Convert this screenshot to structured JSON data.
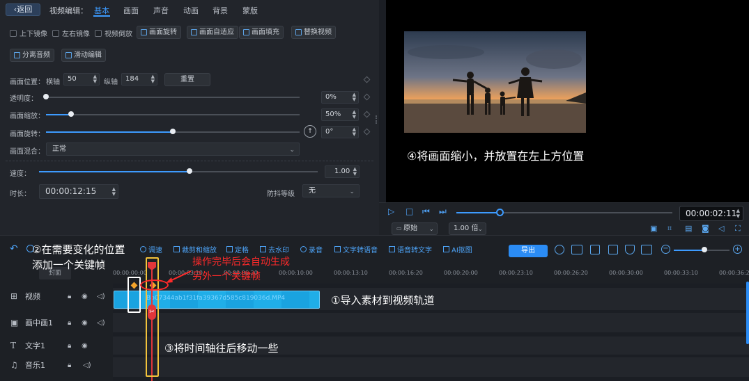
{
  "header": {
    "back_label": "返回",
    "edit_title": "视频编辑：",
    "tabs": [
      "基本",
      "画面",
      "声音",
      "动画",
      "背景",
      "蒙版"
    ]
  },
  "options": {
    "checkboxes": [
      "上下镜像",
      "左右镜像",
      "视频倒放"
    ],
    "buttons_row1": [
      "画面旋转",
      "画面自适应",
      "画面填充",
      "替换视频"
    ],
    "buttons_row2": [
      "分离音频",
      "滑动编辑"
    ]
  },
  "props": {
    "position_label": "画面位置：",
    "x_label": "横轴",
    "x_value": "50",
    "y_label": "纵轴",
    "y_value": "184",
    "reset_label": "重置",
    "opacity_label": "透明度：",
    "opacity_value": "0%",
    "opacity_level": 0.0,
    "scale_label": "画面缩放：",
    "scale_value": "50%",
    "scale_level": 0.1,
    "rotate_label": "画面旋转：",
    "rotate_value": "0°",
    "rotate_level": 0.5,
    "blend_label": "画面混合：",
    "blend_value": "正常",
    "speed_label": "速度：",
    "speed_value": "1.00",
    "speed_level": 0.54,
    "duration_label": "时长：",
    "duration_value": "00:00:12:15",
    "stabilize_label": "防抖等级",
    "stabilize_value": "无"
  },
  "preview": {
    "caption": "④将画面缩小，并放置在左上方位置",
    "current_time": "00:00:02:11",
    "ratio_select": "原始",
    "speed_select": "1.00 倍",
    "progress_level": 0.2
  },
  "toolbar": {
    "tools": [
      "调速",
      "裁剪和缩放",
      "定格",
      "去水印",
      "录音",
      "文字转语音",
      "语音转文字",
      "AI抠图"
    ],
    "export_label": "导出"
  },
  "timeline": {
    "cover_label": "封面",
    "ticks": [
      "00:00:00:00",
      "00:00:03:10",
      "00:00:06:20",
      "00:00:10:00",
      "00:00:13:10",
      "00:00:16:20",
      "00:00:20:00",
      "00:00:23:10",
      "00:00:26:20",
      "00:00:30:00",
      "00:00:33:10",
      "00:00:36:20"
    ],
    "tracks": [
      "视频",
      "画中画1",
      "文字1",
      "音乐1"
    ],
    "clip_name": "Bb07344ab1f31fa39367d585c819036d.MP4"
  },
  "annotations": {
    "step1": "①导入素材到视频轨道",
    "step2_line1": "②在需要变化的位置",
    "step2_line2": "添加一个关键帧",
    "step3": "③将时间轴往后移动一些",
    "auto_line1": "操作完毕后会自动生成",
    "auto_line2": "另外一个关键帧"
  },
  "colors": {
    "accent": "#3d9bff",
    "clip": "#1aa3e0",
    "playhead": "#e2363a",
    "highlight_yellow": "#f3c33b",
    "annotation_red": "#ff2a2a"
  }
}
